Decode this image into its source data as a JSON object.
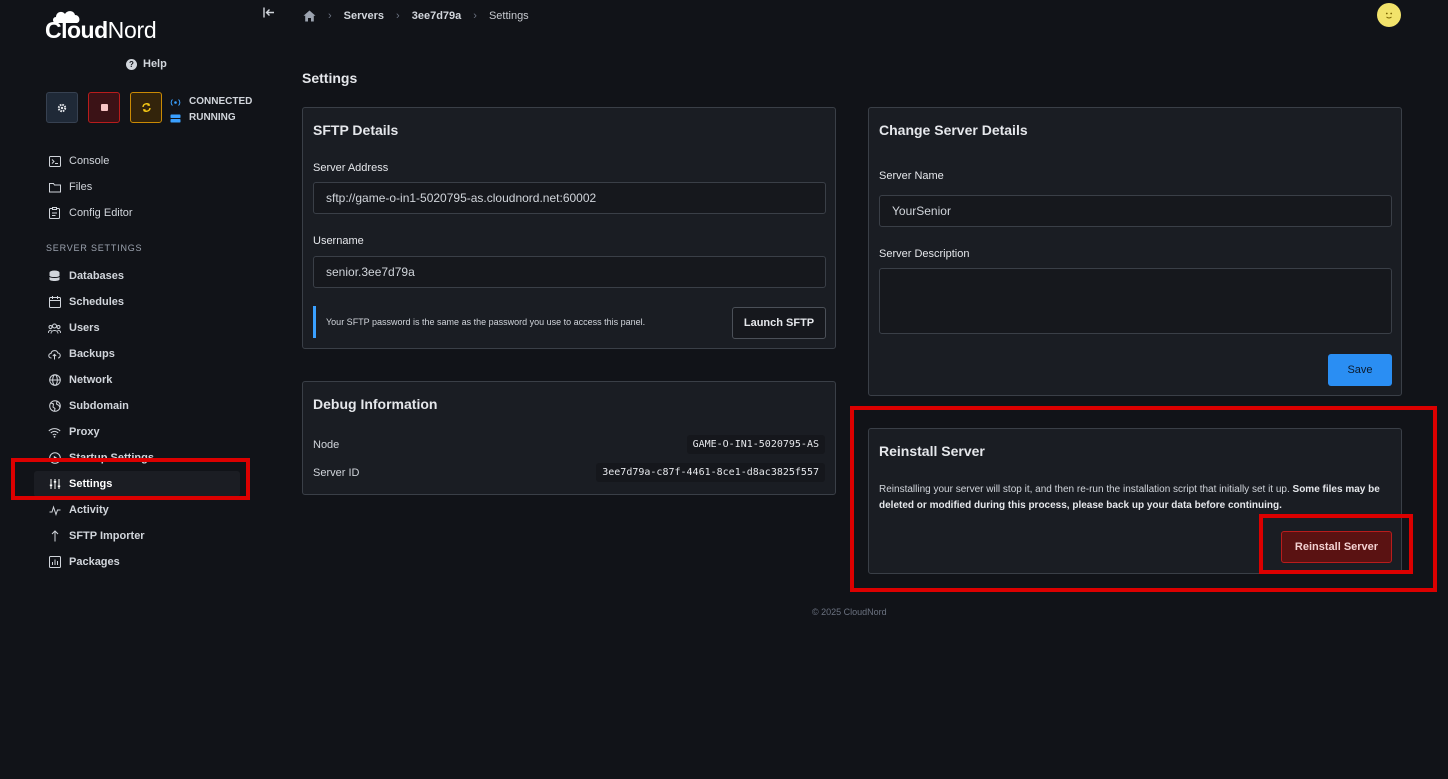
{
  "brand": {
    "cloud": "Cloud",
    "nord": "Nord"
  },
  "help_label": "Help",
  "status": {
    "connected": "CONNECTED",
    "running": "RUNNING"
  },
  "nav_main": [
    {
      "label": "Console",
      "icon": "terminal-icon"
    },
    {
      "label": "Files",
      "icon": "folder-icon"
    },
    {
      "label": "Config Editor",
      "icon": "clipboard-icon"
    }
  ],
  "section_title": "SERVER SETTINGS",
  "nav_settings": [
    {
      "label": "Databases",
      "icon": "database-icon"
    },
    {
      "label": "Schedules",
      "icon": "calendar-icon"
    },
    {
      "label": "Users",
      "icon": "users-icon"
    },
    {
      "label": "Backups",
      "icon": "cloud-upload-icon"
    },
    {
      "label": "Network",
      "icon": "globe-icon"
    },
    {
      "label": "Subdomain",
      "icon": "world-icon"
    },
    {
      "label": "Proxy",
      "icon": "wifi-icon"
    },
    {
      "label": "Startup Settings",
      "icon": "play-circle-icon"
    },
    {
      "label": "Settings",
      "icon": "sliders-icon"
    },
    {
      "label": "Activity",
      "icon": "activity-icon"
    },
    {
      "label": "SFTP Importer",
      "icon": "arrow-up-icon"
    },
    {
      "label": "Packages",
      "icon": "package-icon"
    }
  ],
  "breadcrumb": {
    "servers": "Servers",
    "server_id": "3ee7d79a",
    "current": "Settings"
  },
  "page_title": "Settings",
  "sftp": {
    "title": "SFTP Details",
    "address_label": "Server Address",
    "address_value": "sftp://game-o-in1-5020795-as.cloudnord.net:60002",
    "username_label": "Username",
    "username_value": "senior.3ee7d79a",
    "note": "Your SFTP password is the same as the password you use to access this panel.",
    "launch_label": "Launch SFTP"
  },
  "debug": {
    "title": "Debug Information",
    "node_label": "Node",
    "node_value": "GAME-O-IN1-5020795-AS",
    "server_id_label": "Server ID",
    "server_id_value": "3ee7d79a-c87f-4461-8ce1-d8ac3825f557"
  },
  "details": {
    "title": "Change Server Details",
    "name_label": "Server Name",
    "name_value": "YourSenior",
    "description_label": "Server Description",
    "description_value": "",
    "save_label": "Save"
  },
  "reinstall": {
    "title": "Reinstall Server",
    "text_plain": "Reinstalling your server will stop it, and then re-run the installation script that initially set it up. ",
    "text_bold": "Some files may be deleted or modified during this process, please back up your data before continuing.",
    "button_label": "Reinstall Server"
  },
  "footer": "© 2025 CloudNord",
  "colors": {
    "background": "#111318",
    "card": "#1a1d23",
    "accent_blue": "#2a8ef3",
    "danger": "#b91c1c",
    "highlight_red": "#dc0000"
  }
}
